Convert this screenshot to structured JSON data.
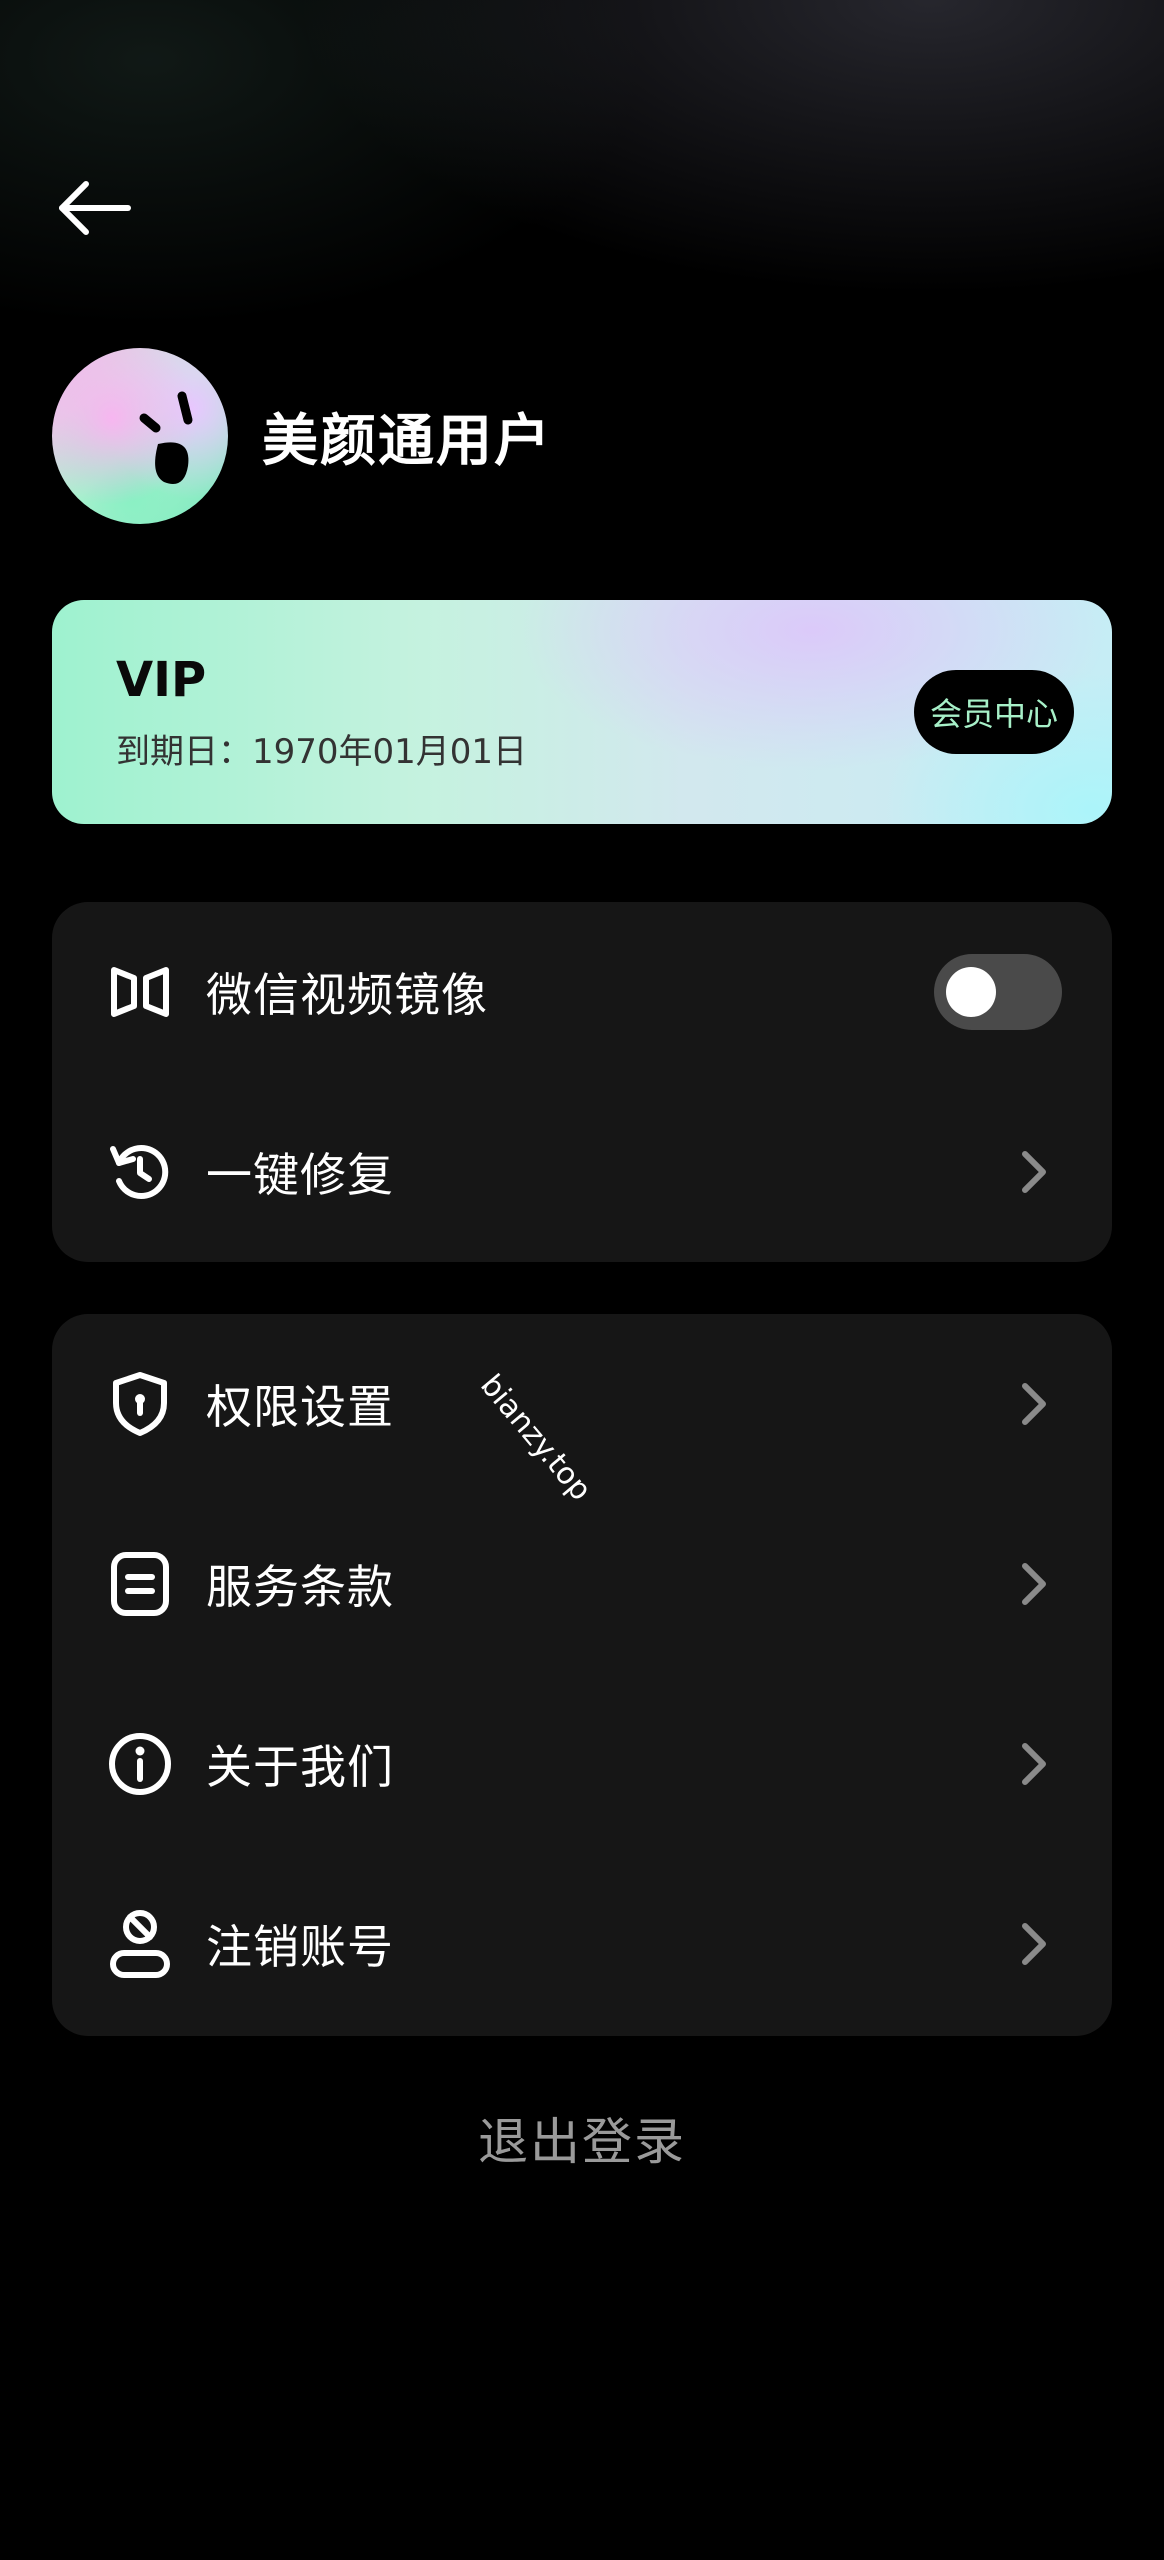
{
  "header": {
    "back_icon": "arrow-left-icon"
  },
  "profile": {
    "avatar_icon": "smiley-face-avatar",
    "username": "美颜通用户"
  },
  "vip": {
    "title": "VIP",
    "expire_text": "到期日：1970年01月01日",
    "member_center_label": "会员中心"
  },
  "section1": {
    "items": [
      {
        "label": "微信视频镜像",
        "icon": "mirror-icon",
        "control": "toggle",
        "toggle_on": false
      },
      {
        "label": "一键修复",
        "icon": "refresh-icon",
        "control": "chevron"
      }
    ]
  },
  "section2": {
    "items": [
      {
        "label": "权限设置",
        "icon": "shield-icon",
        "control": "chevron"
      },
      {
        "label": "服务条款",
        "icon": "document-icon",
        "control": "chevron"
      },
      {
        "label": "关于我们",
        "icon": "info-icon",
        "control": "chevron"
      },
      {
        "label": "注销账号",
        "icon": "user-cancel-icon",
        "control": "chevron"
      }
    ]
  },
  "logout_label": "退出登录",
  "watermark": "bianzy.top",
  "colors": {
    "background": "#000000",
    "section_bg": "#161616",
    "toggle_off": "#4a4a4a",
    "member_btn_text": "#a7f0c8",
    "logout_text": "#9a9a9a"
  }
}
